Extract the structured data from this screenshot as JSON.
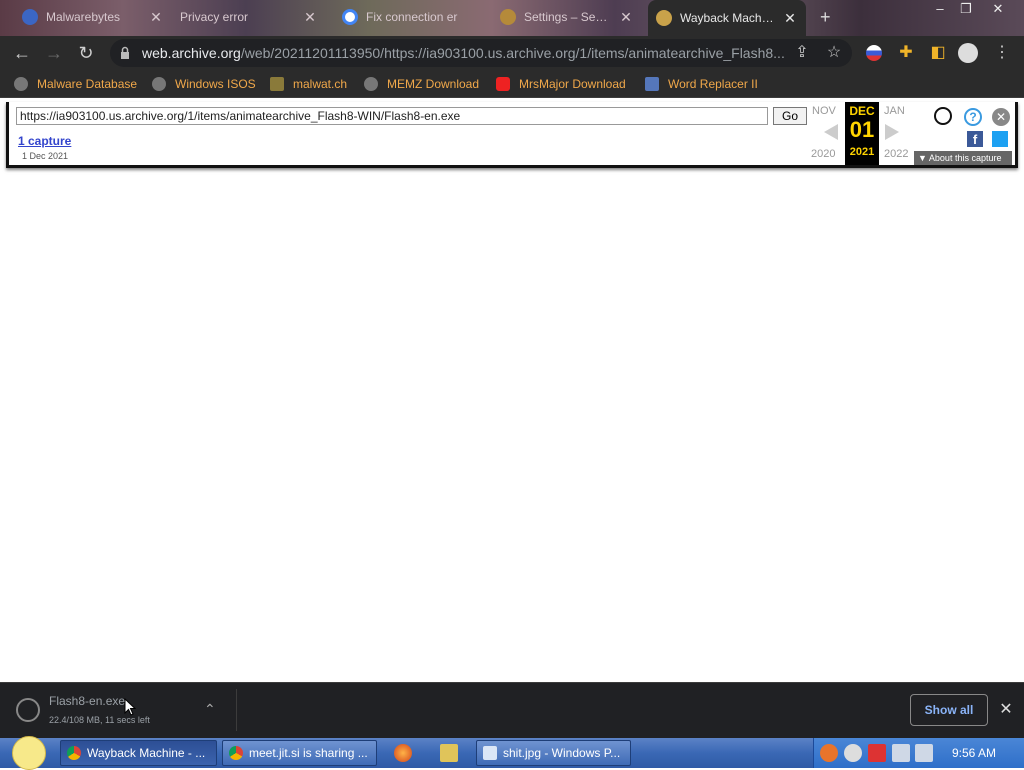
{
  "browser": {
    "tabs": [
      {
        "title": "Malwarebytes",
        "active": false
      },
      {
        "title": "Privacy error",
        "active": false
      },
      {
        "title": "Fix connection er",
        "active": false
      },
      {
        "title": "Settings – Security",
        "active": false
      },
      {
        "title": "Wayback Machine",
        "active": true
      }
    ],
    "new_tab_label": "+",
    "window_controls": {
      "minimize": "–",
      "restore": "❐",
      "close": "✕"
    },
    "omnibox": {
      "host": "web.archive.org",
      "path": "/web/20211201113950/https://ia903100.us.archive.org/1/items/animatearchive_Flash8..."
    },
    "bookmarks": [
      {
        "label": "Malware Database",
        "icon": "globe-icon"
      },
      {
        "label": "Windows ISOS",
        "icon": "globe-icon"
      },
      {
        "label": "malwat.ch",
        "icon": "person-icon"
      },
      {
        "label": "MEMZ Download",
        "icon": "globe-icon"
      },
      {
        "label": "MrsMajor Download",
        "icon": "youtube-icon"
      },
      {
        "label": "Word Replacer II",
        "icon": "wr-icon"
      }
    ]
  },
  "wayback": {
    "url_value": "https://ia903100.us.archive.org/1/items/animatearchive_Flash8-WIN/Flash8-en.exe",
    "go_label": "Go",
    "captures_label": "1 capture",
    "capture_date": "1 Dec 2021",
    "prev_month": "NOV",
    "cur_month": "DEC",
    "cur_day": "01",
    "next_month": "JAN",
    "prev_year": "2020",
    "cur_year": "2021",
    "next_year": "2022",
    "about_label": "About this capture"
  },
  "download": {
    "filename": "Flash8-en.exe",
    "status": "22.4/108 MB, 11 secs left",
    "show_all_label": "Show all"
  },
  "taskbar": {
    "tasks": [
      {
        "label": "Wayback Machine - ...",
        "active": true
      },
      {
        "label": "meet.jit.si is sharing ...",
        "active": false
      },
      {
        "label": "shit.jpg - Windows P...",
        "active": false
      }
    ],
    "clock": "9:56 AM"
  },
  "colors": {
    "accent_bookmark": "#f0a84a",
    "wayback_highlight": "#ffd400",
    "link": "#3344cc"
  }
}
